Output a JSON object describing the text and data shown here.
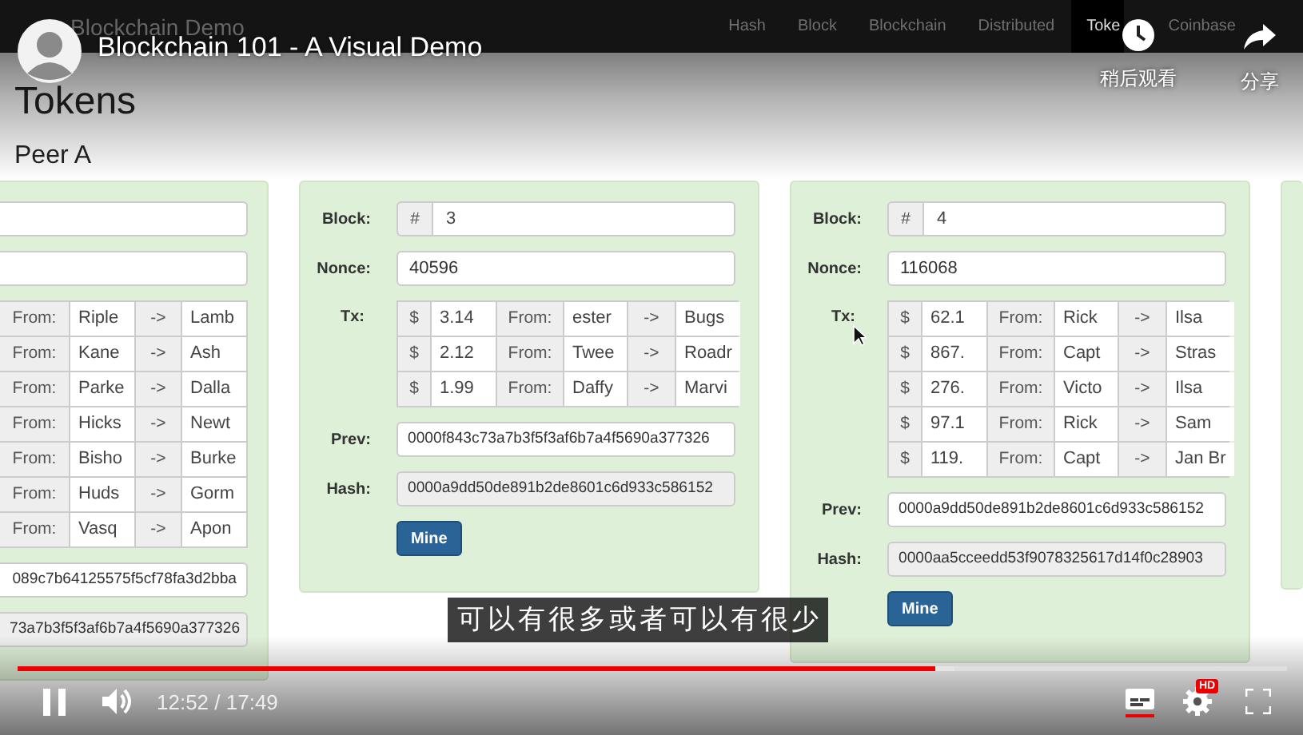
{
  "site": {
    "brand": "Blockchain Demo",
    "nav": [
      {
        "label": "Hash",
        "selected": false
      },
      {
        "label": "Block",
        "selected": false
      },
      {
        "label": "Blockchain",
        "selected": false
      },
      {
        "label": "Distributed",
        "selected": false
      },
      {
        "label": "Toke",
        "selected": true
      },
      {
        "label": "Coinbase",
        "selected": false
      }
    ]
  },
  "page": {
    "title": "Tokens",
    "peer": "Peer A",
    "blocks": [
      {
        "kind": "partial",
        "tx": [
          {
            "from_label": "From:",
            "from": "Riple",
            "arrow": "->",
            "to": "Lamb"
          },
          {
            "from_label": "From:",
            "from": "Kane",
            "arrow": "->",
            "to": "Ash"
          },
          {
            "from_label": "From:",
            "from": "Parke",
            "arrow": "->",
            "to": "Dalla"
          },
          {
            "from_label": "From:",
            "from": "Hicks",
            "arrow": "->",
            "to": "Newt"
          },
          {
            "from_label": "From:",
            "from": "Bisho",
            "arrow": "->",
            "to": "Burke"
          },
          {
            "from_label": "From:",
            "from": "Huds",
            "arrow": "->",
            "to": "Gorm"
          },
          {
            "from_label": "From:",
            "from": "Vasq",
            "arrow": "->",
            "to": "Apon"
          }
        ],
        "prev": "089c7b64125575f5cf78fa3d2bba",
        "hash": "73a7b3f5f3af6b7a4f5690a377326"
      },
      {
        "kind": "full",
        "block_label": "Block:",
        "number_sign": "#",
        "block": "3",
        "nonce_label": "Nonce:",
        "nonce": "40596",
        "tx_label": "Tx:",
        "tx": [
          {
            "currency": "$",
            "amount": "3.14",
            "from_label": "From:",
            "from": "ester",
            "arrow": "->",
            "to": "Bugs"
          },
          {
            "currency": "$",
            "amount": "2.12",
            "from_label": "From:",
            "from": "Twee",
            "arrow": "->",
            "to": "Roadr"
          },
          {
            "currency": "$",
            "amount": "1.99",
            "from_label": "From:",
            "from": "Daffy",
            "arrow": "->",
            "to": "Marvi"
          }
        ],
        "prev_label": "Prev:",
        "prev": "0000f843c73a7b3f5f3af6b7a4f5690a377326",
        "hash_label": "Hash:",
        "hash": "0000a9dd50de891b2de8601c6d933c586152",
        "button": "Mine"
      },
      {
        "kind": "full",
        "block_label": "Block:",
        "number_sign": "#",
        "block": "4",
        "nonce_label": "Nonce:",
        "nonce": "116068",
        "tx_label": "Tx:",
        "tx": [
          {
            "currency": "$",
            "amount": "62.1",
            "from_label": "From:",
            "from": "Rick",
            "arrow": "->",
            "to": "Ilsa"
          },
          {
            "currency": "$",
            "amount": "867.",
            "from_label": "From:",
            "from": "Capt",
            "arrow": "->",
            "to": "Stras"
          },
          {
            "currency": "$",
            "amount": "276.",
            "from_label": "From:",
            "from": "Victo",
            "arrow": "->",
            "to": "Ilsa"
          },
          {
            "currency": "$",
            "amount": "97.1",
            "from_label": "From:",
            "from": "Rick",
            "arrow": "->",
            "to": "Sam"
          },
          {
            "currency": "$",
            "amount": "119.",
            "from_label": "From:",
            "from": "Capt",
            "arrow": "->",
            "to": "Jan Br"
          }
        ],
        "prev_label": "Prev:",
        "prev": "0000a9dd50de891b2de8601c6d933c586152",
        "hash_label": "Hash:",
        "hash": "0000aa5cceedd53f9078325617d14f0c28903",
        "button": "Mine"
      },
      {
        "kind": "edge"
      }
    ]
  },
  "video": {
    "title": "Blockchain 101 - A Visual Demo",
    "actions": [
      {
        "kind": "clock",
        "label": "稍后观看"
      },
      {
        "kind": "share",
        "label": "分享"
      }
    ],
    "subtitle": "可以有很多或者可以有很少",
    "buffer": {
      "level": 0.738
    },
    "progress": {
      "level": 0.723
    },
    "playing": true,
    "time": "12:52 / 17:49",
    "captions_on": true,
    "quality_badge": "HD"
  }
}
